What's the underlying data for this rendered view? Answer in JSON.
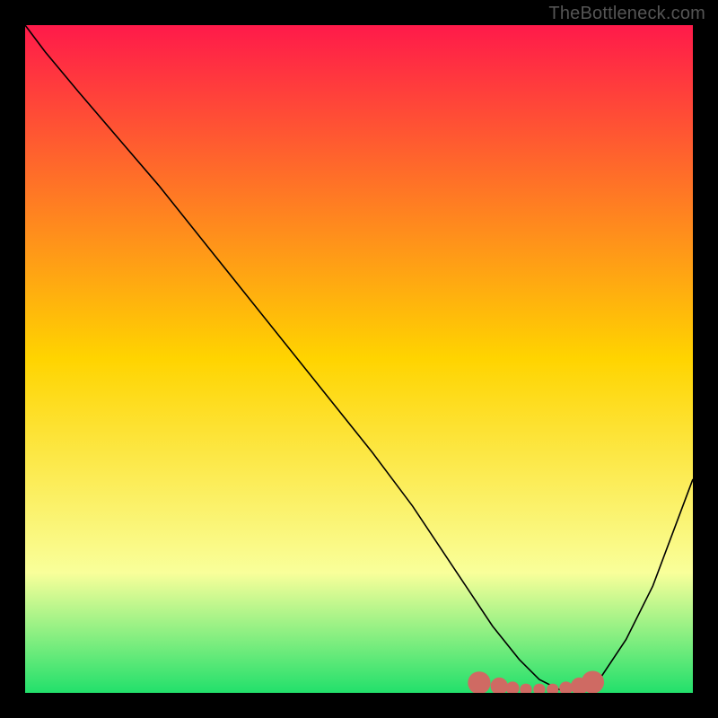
{
  "watermark": "TheBottleneck.com",
  "colors": {
    "frame": "#000000",
    "gradient_top": "#ff1a4a",
    "gradient_mid": "#ffd400",
    "gradient_band_light": "#f9ff9a",
    "gradient_bottom": "#22e06b",
    "curve": "#000000",
    "marker": "#cf6a63"
  },
  "chart_data": {
    "type": "line",
    "title": "",
    "xlabel": "",
    "ylabel": "",
    "xlim": [
      0,
      100
    ],
    "ylim": [
      0,
      100
    ],
    "grid": false,
    "legend": false,
    "series": [
      {
        "name": "bottleneck-curve",
        "x": [
          0,
          3,
          8,
          14,
          20,
          28,
          36,
          44,
          52,
          58,
          62,
          66,
          70,
          74,
          77,
          80,
          83,
          86,
          90,
          94,
          100
        ],
        "y": [
          100,
          96,
          90,
          83,
          76,
          66,
          56,
          46,
          36,
          28,
          22,
          16,
          10,
          5,
          2,
          0.5,
          0.5,
          2,
          8,
          16,
          32
        ]
      }
    ],
    "markers": {
      "name": "optimal-zone",
      "x": [
        68,
        71,
        73,
        75,
        77,
        79,
        81,
        83,
        85
      ],
      "y": [
        1.5,
        1.0,
        0.7,
        0.5,
        0.5,
        0.5,
        0.7,
        1.0,
        1.6
      ],
      "radius": [
        1.7,
        1.3,
        1.0,
        0.9,
        0.9,
        0.9,
        1.0,
        1.3,
        1.7
      ]
    }
  }
}
